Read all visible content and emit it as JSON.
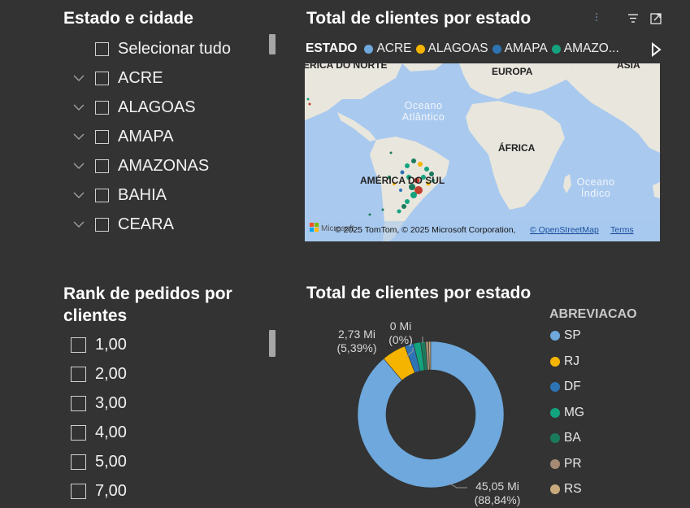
{
  "slicer_state": {
    "title": "Estado e cidade",
    "select_all": "Selecionar tudo",
    "items": [
      "ACRE",
      "ALAGOAS",
      "AMAPA",
      "AMAZONAS",
      "BAHIA",
      "CEARA"
    ]
  },
  "slicer_rank": {
    "title_line1": "Rank de pedidos por",
    "title_line2": "clientes",
    "items": [
      "1,00",
      "2,00",
      "3,00",
      "4,00",
      "5,00",
      "7,00"
    ]
  },
  "map_visual": {
    "title": "Total de clientes por estado",
    "legend_title": "ESTADO",
    "legend_items": [
      {
        "label": "ACRE",
        "color": "#6ea8dc"
      },
      {
        "label": "ALAGOAS",
        "color": "#f5b400"
      },
      {
        "label": "AMAPA",
        "color": "#2e74b5"
      },
      {
        "label": "AMAZO...",
        "color": "#14a37f"
      }
    ],
    "labels": {
      "north_america": "ÉRICA DO NORTE",
      "europe": "EUROPA",
      "asia": "ÁSIA",
      "atlantic_1": "Oceano",
      "atlantic_2": "Atlântico",
      "africa": "ÁFRICA",
      "south_america": "AMÉRICA DO SUL",
      "indian_1": "Oceano",
      "indian_2": "Índico"
    },
    "attribution": "© 2025 TomTom, © 2025 Microsoft Corporation,",
    "osm_link": "© OpenStreetMap",
    "terms_link": "Terms",
    "microsoft_logo": "Microsoft"
  },
  "donut_visual": {
    "title": "Total de clientes por estado",
    "legend_title": "ABREVIACAO",
    "data_labels": {
      "big_value": "45,05 Mi",
      "big_pct": "(88,84%)",
      "second_value": "2,73 Mi",
      "second_pct": "(5,39%)",
      "small_value": "0 Mi",
      "small_pct": "(0%)"
    }
  },
  "chart_data": {
    "type": "pie",
    "title": "Total de clientes por estado",
    "legend_title": "ABREVIACAO",
    "categories": [
      "SP",
      "RJ",
      "DF",
      "MG",
      "BA",
      "PR",
      "RS"
    ],
    "values": [
      45.05,
      2.73,
      1.0,
      0.8,
      0.55,
      0.35,
      0.23
    ],
    "percent_labels": {
      "SP": "88,84%",
      "RJ": "5,39%"
    },
    "colors": [
      "#6ea8dc",
      "#f5b400",
      "#2e74b5",
      "#14a37f",
      "#1b7a5c",
      "#a48a74",
      "#c8aa7c"
    ],
    "unit": "Mi"
  }
}
